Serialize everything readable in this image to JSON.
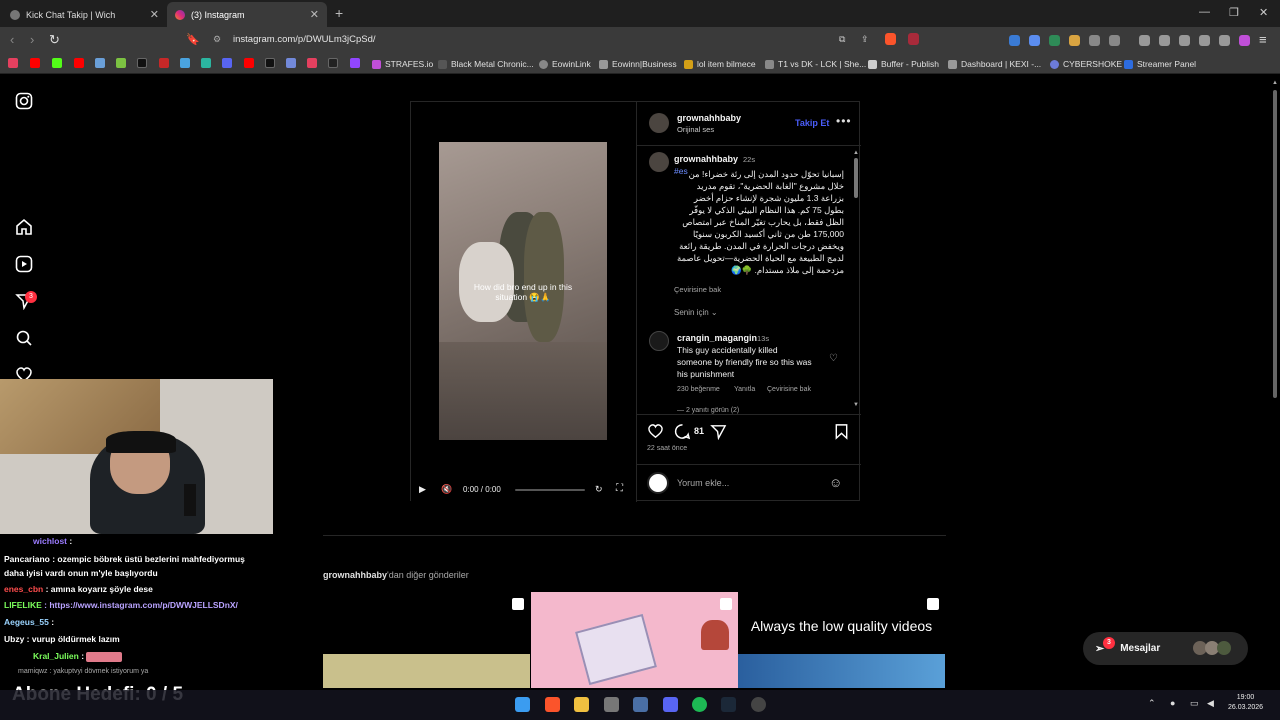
{
  "tabs": [
    {
      "title": "Kick Chat Takip | Wich"
    },
    {
      "title": "(3) Instagram"
    }
  ],
  "address": {
    "url": "instagram.com/p/DWULm3jCpSd/"
  },
  "bookmarks": [
    "STRAFES.io",
    "Black Metal Chronic...",
    "EowinLink",
    "Eowinn|Business",
    "lol item bilmece",
    "T1 vs DK - LCK | She...",
    "Buffer - Publish",
    "Dashboard | KEXI -...",
    "CYBERSHOKE",
    "Streamer Panel"
  ],
  "sidebar": {
    "notif_badge": "3"
  },
  "post": {
    "video_caption": "How did bro end up in this situation 😭🙏",
    "video_time": "0:00 / 0:00",
    "author": "grownahhbaby",
    "audio": "Orijinal ses",
    "follow_label": "Takip Et",
    "caption_user": "grownahhbaby",
    "caption_age": "22s",
    "caption_tag": "#es",
    "caption_text": "إسبانيا تحوّل حدود المدن إلى رئة خضراء! من خلال مشروع \"الغابة الحضرية\"، تقوم مدريد بزراعة 1.3 مليون شجرة لإنشاء حزام أخضر بطول 75 كم. هذا النظام البيئي الذكي لا يوفّر الظل فقط، بل يحارب تغيّر المناخ عبر امتصاص 175,000 طن من ثاني أكسيد الكربون سنويًا ويخفض درجات الحرارة في المدن. طريقة رائعة لدمج الطبيعة مع الحياة الحضرية—تحويل عاصمة مزدحمة إلى ملاذ مستدام. 🌳🌍",
    "see_translation": "Çevirisine bak",
    "for_you": "Senin için",
    "comment": {
      "user": "crangin_magangin",
      "age": "13s",
      "text": "This guy accidentally killed someone by friendly fire so this was his punishment",
      "likes": "230 beğenme",
      "reply": "Yanıtla",
      "translate": "Çevirisine bak"
    },
    "hidden_replies": "— 2 yanıtı görün (2)",
    "comment_count": "81",
    "posted": "22 saat önce",
    "add_comment_placeholder": "Yorum ekle..."
  },
  "more_posts": {
    "user": "grownahhbaby",
    "suffix": "'dan diğer gönderiler",
    "thumb3_text": "Always the low quality videos"
  },
  "messages": {
    "label": "Mesajlar",
    "badge": "3"
  },
  "overlay": {
    "chat": [
      {
        "user": "wichlost",
        "text": " : ",
        "color": "#9b7bff"
      },
      {
        "user": "Pancariano",
        "text": " : ozempic böbrek üstü bezlerini mahfediyormuş",
        "color": "#ffffff"
      },
      {
        "user": "",
        "text": "daha iyisi vardı onun m'yle başlıyordu",
        "color": "#ffffff"
      },
      {
        "user": "enes_cbn",
        "text": " : amına koyarız şöyle dese",
        "color": "#ff4d4d"
      },
      {
        "user": "LIFELIKE",
        "text": " : https://www.instagram.com/p/DWWJELLSDnX/",
        "color": "#7cff5c"
      },
      {
        "user": "Aegeus_55",
        "text": " : ",
        "color": "#9bd4ff"
      },
      {
        "user": "Ubzy",
        "text": " : vurup öldürmek lazım",
        "color": "#ffffff"
      },
      {
        "user": "Kral_Julien",
        "text": " : ",
        "color": "#7cff5c"
      },
      {
        "user": "mamiqwz",
        "text": " : yakuptvyi dövmek istiyorum ya",
        "color": "#aaaaaa"
      }
    ],
    "sub_goal": "Abone Hedefi:  0 / 5"
  },
  "clock": {
    "time": "19:00",
    "date": "26.03.2026"
  }
}
